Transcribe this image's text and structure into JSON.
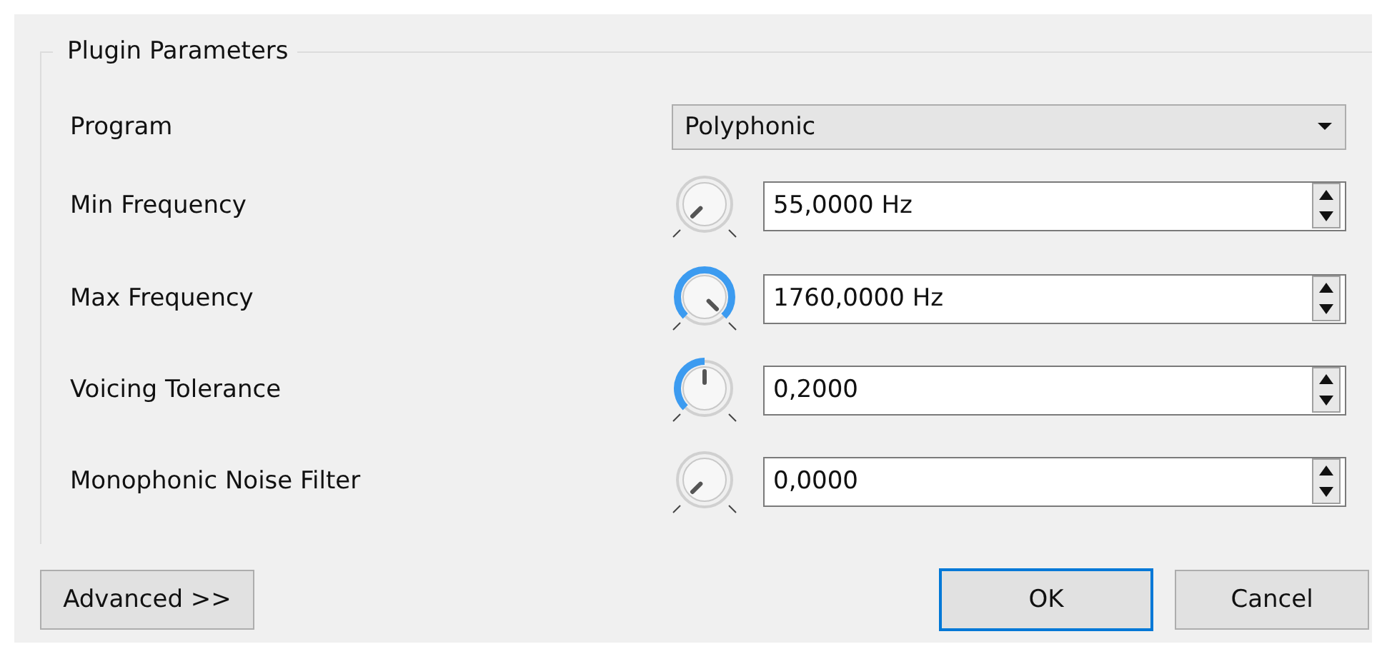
{
  "group": {
    "title": "Plugin Parameters"
  },
  "program": {
    "label": "Program",
    "value": "Polyphonic"
  },
  "parameters": [
    {
      "label": "Min Frequency",
      "value": "55,0000 Hz"
    },
    {
      "label": "Max Frequency",
      "value": "1760,0000 Hz"
    },
    {
      "label": "Voicing Tolerance",
      "value": "0,2000"
    },
    {
      "label": "Monophonic Noise Filter",
      "value": "0,0000"
    }
  ],
  "buttons": [
    {
      "label": "Advanced >>",
      "kind": "plain"
    },
    {
      "label": "OK",
      "kind": "default"
    },
    {
      "label": "Cancel",
      "kind": "plain"
    }
  ]
}
